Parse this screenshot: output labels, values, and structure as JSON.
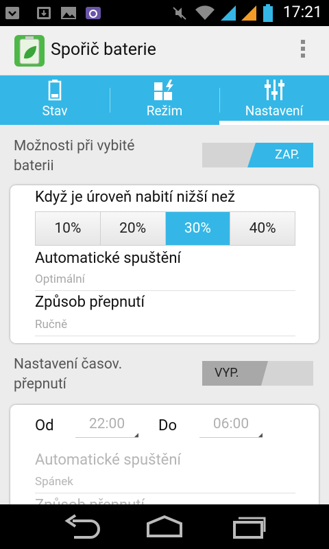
{
  "status_bar": {
    "time": "17:21",
    "icons": [
      "notification-icon",
      "download-icon",
      "image-icon",
      "camera-icon",
      "mute-icon",
      "wifi-icon",
      "signal-icon",
      "signal-icon",
      "battery-icon"
    ]
  },
  "action_bar": {
    "title": "Spořič baterie",
    "icon": "battery-leaf-icon"
  },
  "tabs": [
    {
      "label": "Stav",
      "icon": "battery-icon",
      "active": false
    },
    {
      "label": "Režim",
      "icon": "mode-icon",
      "active": false
    },
    {
      "label": "Nastavení",
      "icon": "sliders-icon",
      "active": true
    }
  ],
  "low_battery": {
    "title": "Možnosti při vybité baterii",
    "toggle": "ZAP.",
    "threshold_label": "Když je úroveň nabití nižší než",
    "options": [
      "10%",
      "20%",
      "30%",
      "40%"
    ],
    "selected": "30%",
    "auto_start": {
      "label": "Automatické spuštění",
      "value": "Optimální"
    },
    "switch_mode": {
      "label": "Způsob přepnutí",
      "value": "Ručně"
    }
  },
  "timed": {
    "title": "Nastavení časov. přepnutí",
    "toggle": "VYP.",
    "from_label": "Od",
    "from_value": "22:00",
    "to_label": "Do",
    "to_value": "06:00",
    "auto_start": {
      "label": "Automatické spuštění",
      "value": "Spánek"
    },
    "switch_mode": {
      "label": "Způsob přepnutí"
    }
  },
  "colors": {
    "accent": "#34b7e6",
    "action_bar_bg": "#f0f0f0",
    "content_bg": "#ececec"
  }
}
